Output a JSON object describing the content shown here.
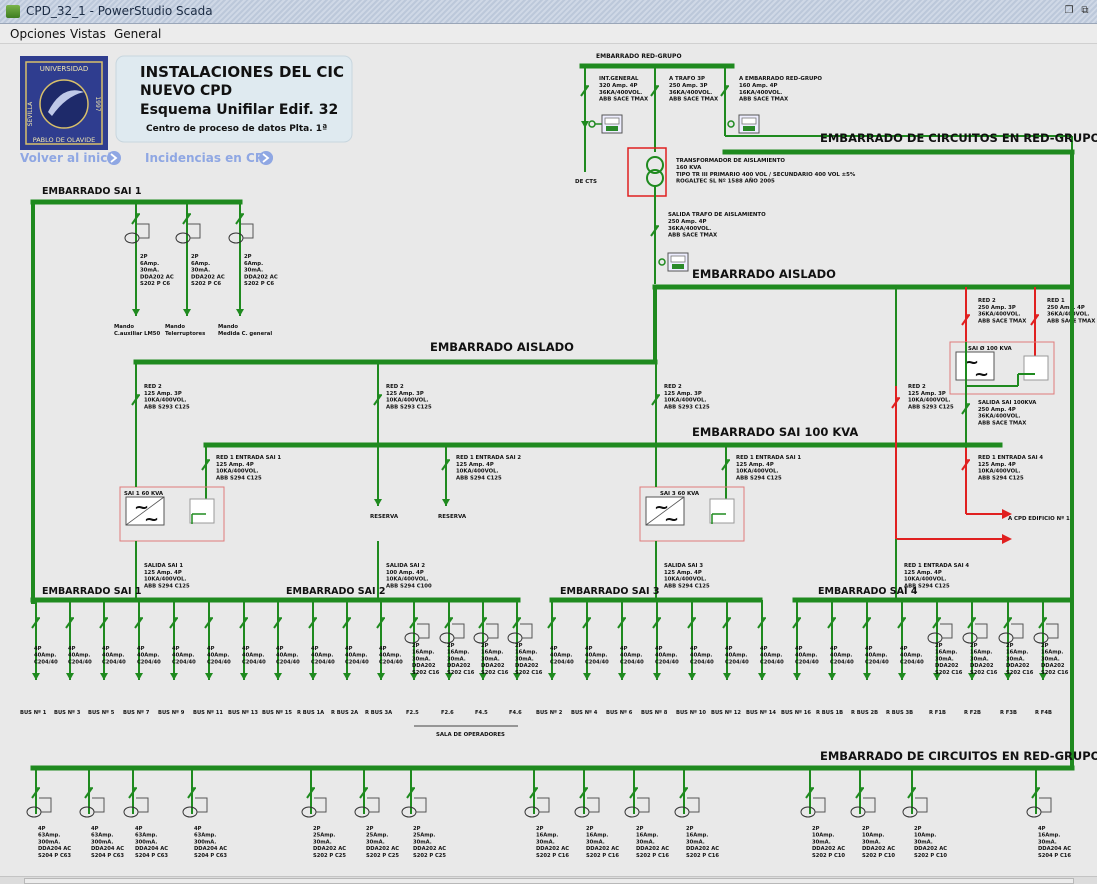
{
  "window": {
    "title": "CPD_32_1 - PowerStudio Scada"
  },
  "menu": [
    "Opciones",
    "Vistas",
    "General"
  ],
  "header": {
    "university": [
      "UNIVERSIDAD",
      "SEVILLA",
      "PABLO DE OLAVIDE",
      "1997"
    ],
    "title1": "INSTALACIONES DEL CIC",
    "title2": "NUEVO CPD",
    "title3": "Esquema Unifilar Edif. 32",
    "title4": "Centro de proceso de datos Plta. 1ª",
    "link_home": "Volver al inicio",
    "link_incidents": "Incidencias en CPD"
  },
  "busbars": {
    "red_grupo_top": "EMBARRADO RED-GRUPO",
    "circuitos_red_grupo": "EMBARRADO DE CIRCUITOS EN RED-GRUPO",
    "sai1": "EMBARRADO SAI 1",
    "aislado": "EMBARRADO AISLADO",
    "sai100": "EMBARRADO SAI 100 KVA",
    "sai2": "EMBARRADO SAI 2",
    "sai3": "EMBARRADO SAI 3",
    "sai4": "EMBARRADO SAI 4"
  },
  "top_breakers": [
    {
      "text": [
        "INT.GENERAL",
        "320 Amp. 4P",
        "36KA/400VOL.",
        "ABB SACE TMAX"
      ]
    },
    {
      "text": [
        "A TRAFO 3P",
        "250 Amp. 3P",
        "36KA/400VOL.",
        "ABB SACE TMAX"
      ]
    },
    {
      "text": [
        "A EMBARRADO RED-GRUPO",
        "160 Amp. 4P",
        "16KA/400VOL.",
        "ABB SACE TMAX"
      ]
    }
  ],
  "de_cts": "DE CTS",
  "transformer": [
    "TRANSFORMADOR DE AISLAMIENTO",
    "160 KVA",
    "TIPO TR III PRIMARIO 400 VOL / SECUNDARIO 400 VOL ±5%",
    "ROGALTEC SL Nº 1588 AÑO 2005"
  ],
  "trafo_out": [
    "SALIDA TRAFO DE AISLAMIENTO",
    "250 Amp. 4P",
    "36KA/400VOL.",
    "ABB SACE TMAX"
  ],
  "sai1_feeders": [
    {
      "text": [
        "2P",
        "6Amp.",
        "30mA.",
        "DDA202 AC",
        "S202 P C6"
      ],
      "load": [
        "Mando",
        "C.auxiliar LM50"
      ]
    },
    {
      "text": [
        "2P",
        "6Amp.",
        "30mA.",
        "DDA202 AC",
        "S202 P C6"
      ],
      "load": [
        "Mando",
        "Telerruptores"
      ]
    },
    {
      "text": [
        "2P",
        "6Amp.",
        "30mA.",
        "DDA202 AC",
        "S202 P C6"
      ],
      "load": [
        "Mando",
        "Medida C. general"
      ]
    }
  ],
  "red2_breaker": [
    "RED 2",
    "125 Amp. 3P",
    "10KA/400VOL.",
    "ABB S293 C125"
  ],
  "red1_entries": [
    [
      "RED 1  ENTRADA SAI 1",
      "125 Amp. 4P",
      "10KA/400VOL.",
      "ABB S294 C125"
    ],
    [
      "RED 1  ENTRADA SAI 2",
      "125 Amp. 4P",
      "10KA/400VOL.",
      "ABB S294 C125"
    ],
    [
      "RED 1  ENTRADA SAI 1",
      "125 Amp. 4P",
      "10KA/400VOL.",
      "ABB S294 C125"
    ],
    [
      "RED 1  ENTRADA SAI 4",
      "125 Amp. 4P",
      "10KA/400VOL.",
      "ABB S294 C125"
    ]
  ],
  "red_tmax": [
    [
      "RED 2",
      "250 Amp. 3P",
      "36KA/400VOL.",
      "ABB SACE TMAX"
    ],
    [
      "RED 1",
      "250 Amp. 4P",
      "36KA/400VOL.",
      "ABB SACE TMAX"
    ]
  ],
  "sai_labels": [
    "SAI 1 60 KVA",
    "SAI 3 60 KVA",
    "SAI Ø 100 KVA"
  ],
  "reserva": "RESERVA",
  "salida_sai100": [
    "SALIDA SAI 100KVA",
    "250 Amp. 4P",
    "36KA/400VOL.",
    "ABB SACE TMAX"
  ],
  "cpd_edificio": "A CPD EDIFICIO Nº 1",
  "salidas": [
    [
      "SALIDA SAI 1",
      "125 Amp. 4P",
      "10KA/400VOL.",
      "ABB S294 C125"
    ],
    [
      "SALIDA SAI 2",
      "100 Amp. 4P",
      "10KA/400VOL.",
      "ABB S294 C100"
    ],
    [
      "SALIDA SAI 3",
      "125 Amp. 4P",
      "10KA/400VOL.",
      "ABB S294 C125"
    ],
    [
      "RED 1  ENTRADA SAI 4",
      "125 Amp. 4P",
      "10KA/400VOL.",
      "ABB S294 C125"
    ]
  ],
  "bus_breaker_4p": [
    "4P",
    "40Amp.",
    "C204/40"
  ],
  "bus_breaker_2p": [
    "2P",
    "16Amp.",
    "30mA.",
    "DDA202",
    "S202 C16"
  ],
  "buses": [
    "BUS Nº 1",
    "BUS Nº 3",
    "BUS Nº 5",
    "BUS Nº 7",
    "BUS Nº 9",
    "BUS Nº 11",
    "BUS Nº 13",
    "BUS Nº 15",
    "R BUS 1A",
    "R BUS 2A",
    "R BUS 3A",
    "F2.5",
    "F2.6",
    "F4.5",
    "F4.6",
    "BUS Nº 2",
    "BUS Nº 4",
    "BUS Nº 6",
    "BUS Nº 8",
    "BUS Nº 10",
    "BUS Nº 12",
    "BUS Nº 14",
    "BUS Nº 16",
    "R BUS 1B",
    "R BUS 2B",
    "R BUS 3B",
    "R F1B",
    "R F2B",
    "R F3B",
    "R F4B"
  ],
  "sala_operadores": "SALA DE OPERADORES",
  "bottom_feeders": [
    [
      "4P",
      "63Amp.",
      "300mA.",
      "DDA204 AC",
      "S204 P C63"
    ],
    [
      "4P",
      "63Amp.",
      "300mA.",
      "DDA204 AC",
      "S204 P C63"
    ],
    [
      "4P",
      "63Amp.",
      "300mA.",
      "DDA204 AC",
      "S204 P C63"
    ],
    [
      "4P",
      "63Amp.",
      "300mA.",
      "DDA204 AC",
      "S204 P C63"
    ],
    [
      "2P",
      "25Amp.",
      "30mA.",
      "DDA202 AC",
      "S202 P C25"
    ],
    [
      "2P",
      "25Amp.",
      "30mA.",
      "DDA202 AC",
      "S202 P C25"
    ],
    [
      "2P",
      "25Amp.",
      "30mA.",
      "DDA202 AC",
      "S202 P C25"
    ],
    [
      "2P",
      "16Amp.",
      "30mA.",
      "DDA202 AC",
      "S202 P C16"
    ],
    [
      "2P",
      "16Amp.",
      "30mA.",
      "DDA202 AC",
      "S202 P C16"
    ],
    [
      "2P",
      "16Amp.",
      "30mA.",
      "DDA202 AC",
      "S202 P C16"
    ],
    [
      "2P",
      "16Amp.",
      "30mA.",
      "DDA202 AC",
      "S202 P C16"
    ],
    [
      "2P",
      "10Amp.",
      "30mA.",
      "DDA202 AC",
      "S202 P C10"
    ],
    [
      "2P",
      "10Amp.",
      "30mA.",
      "DDA202 AC",
      "S202 P C10"
    ],
    [
      "2P",
      "10Amp.",
      "30mA.",
      "DDA202 AC",
      "S202 P C10"
    ],
    [
      "4P",
      "16Amp.",
      "30mA.",
      "DDA204 AC",
      "S204 P C16"
    ]
  ],
  "colors": {
    "bus": "#1f8a1f",
    "alarm": "#e02020",
    "link": "#8fa7e3",
    "panel": "#dde9ef"
  }
}
